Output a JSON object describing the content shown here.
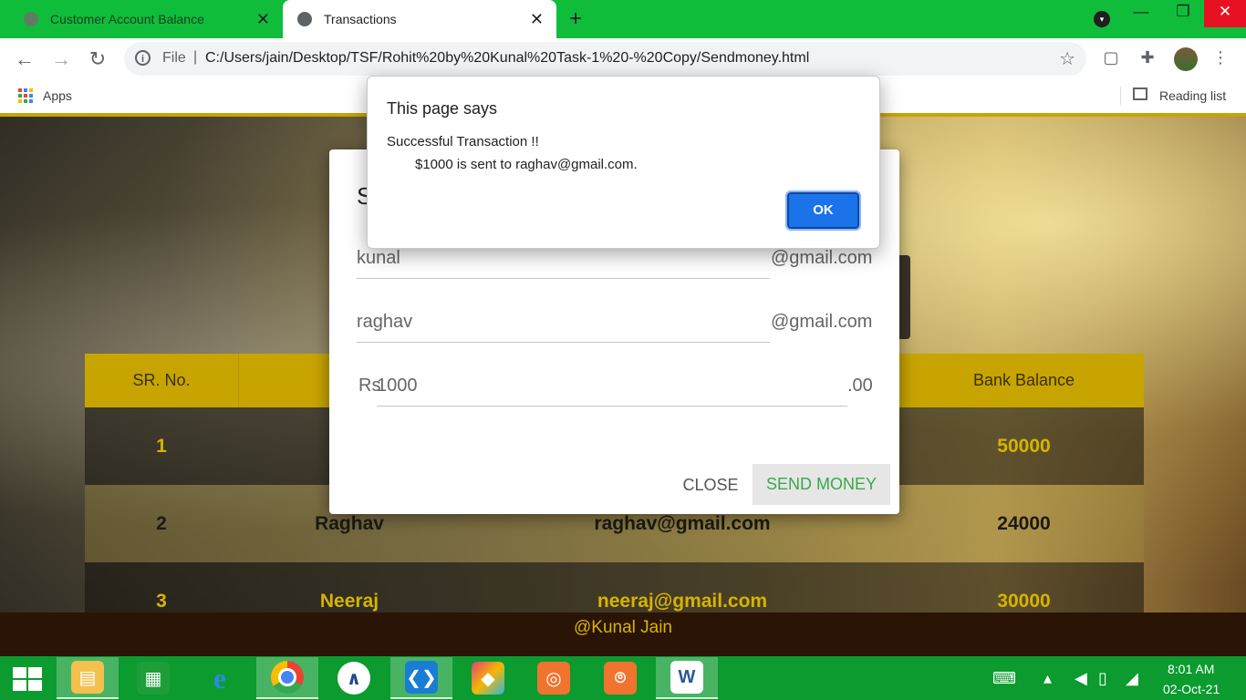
{
  "browser": {
    "tabs": [
      {
        "title": "Customer Account Balance",
        "active": false
      },
      {
        "title": "Transactions",
        "active": true
      }
    ],
    "address": {
      "scheme_label": "File",
      "url": "C:/Users/jain/Desktop/TSF/Rohit%20by%20Kunal%20Task-1%20-%20Copy/Sendmoney.html"
    },
    "bookmarks": {
      "apps_label": "Apps",
      "reading_list_label": "Reading list"
    },
    "icons": [
      "back-icon",
      "forward-icon",
      "reload-icon",
      "info-icon",
      "star-icon",
      "pocket-icon",
      "extensions-icon",
      "menu-icon"
    ]
  },
  "page": {
    "table": {
      "headers": [
        "SR. No.",
        "",
        "",
        "Bank Balance"
      ],
      "rows": [
        {
          "sr": "1",
          "name": "",
          "email": "",
          "balance": "50000"
        },
        {
          "sr": "2",
          "name": "Raghav",
          "email": "raghav@gmail.com",
          "balance": "24000"
        },
        {
          "sr": "3",
          "name": "Neeraj",
          "email": "neeraj@gmail.com",
          "balance": "30000"
        }
      ]
    },
    "footer": "@Kunal Jain"
  },
  "modal": {
    "title_partial": "S",
    "sender_value": "kunal",
    "sender_suffix": "@gmail.com",
    "receiver_value": "raghav",
    "receiver_suffix": "@gmail.com",
    "amount_prefix": "Rs",
    "amount_value": "1000",
    "amount_suffix": ".00",
    "close_label": "CLOSE",
    "send_label": "SEND MONEY"
  },
  "alert": {
    "title": "This page says",
    "line1": "Successful Transaction !!",
    "line2": "$1000 is sent to raghav@gmail.com.",
    "ok_label": "OK"
  },
  "taskbar": {
    "apps": [
      "file-explorer",
      "store",
      "internet-explorer",
      "chrome",
      "arduino",
      "vscode",
      "app-box",
      "camera-app-1",
      "camera-app-2",
      "word"
    ],
    "time": "8:01 AM",
    "date": "02-Oct-21"
  },
  "colors": {
    "tab_strip": "#0fbd3b",
    "accent_gold": "#c7a400",
    "taskbar": "#0b9b2f",
    "send_green": "#3aa84a",
    "ok_blue": "#1a73e8"
  }
}
